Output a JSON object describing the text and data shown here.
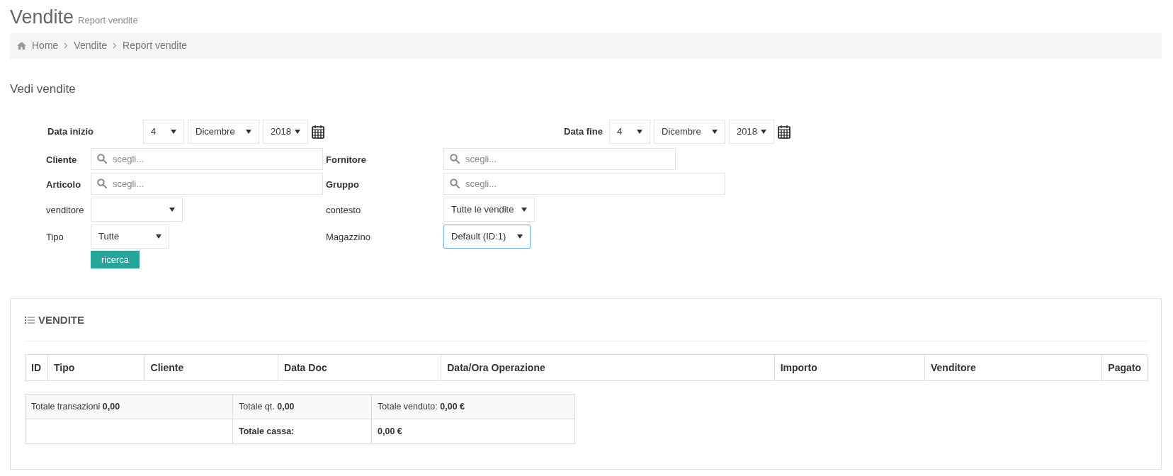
{
  "page": {
    "title": "Vendite",
    "subtitle": "Report vendite"
  },
  "breadcrumb": [
    {
      "label": "Home",
      "kind": "home"
    },
    {
      "label": "Vendite",
      "kind": "link"
    },
    {
      "label": "Report vendite",
      "kind": "link"
    }
  ],
  "form": {
    "title": "Vedi vendite",
    "date_start": {
      "label": "Data inizio",
      "day": "4",
      "month": "Dicembre",
      "year": "2018"
    },
    "date_end": {
      "label": "Data fine",
      "day": "4",
      "month": "Dicembre",
      "year": "2018"
    },
    "rows": [
      [
        {
          "label": "Cliente",
          "emphasized": true,
          "kind": "search",
          "placeholder": "scegli..."
        },
        {
          "label": "Fornitore",
          "emphasized": true,
          "kind": "search",
          "placeholder": "scegli..."
        }
      ],
      [
        {
          "label": "Articolo",
          "emphasized": true,
          "kind": "search",
          "placeholder": "scegli..."
        },
        {
          "label": "Gruppo",
          "emphasized": true,
          "kind": "search",
          "placeholder": "scegli..."
        }
      ],
      [
        {
          "label": "venditore",
          "emphasized": false,
          "kind": "select",
          "focused": false
        },
        {
          "label": "contesto",
          "emphasized": false,
          "kind": "select",
          "value": "Tutte le vendite",
          "focused": false
        }
      ],
      [
        {
          "label": "Tipo",
          "emphasized": false,
          "kind": "select",
          "value": "Tutte",
          "focused": false
        },
        {
          "label": "Magazzino",
          "emphasized": false,
          "kind": "select",
          "value": "Default (ID:1)",
          "focused": true
        }
      ]
    ],
    "submit": "ricerca"
  },
  "panel": {
    "title": "VENDITE",
    "table": {
      "columns": [
        "ID",
        "Tipo",
        "Cliente",
        "Data Doc",
        "Data/Ora Operazione",
        "Importo",
        "Venditore",
        "Pagato"
      ]
    },
    "totals": [
      [
        {
          "text": "Totale transazioni **0,00**"
        },
        {
          "text": "Totale qt. **0,00**"
        },
        {
          "text": "Totale venduto: **0,00 €**"
        }
      ],
      [
        {
          "text": "**Totale cassa:**"
        },
        {
          "text": "**0,00 €**"
        }
      ]
    ]
  }
}
